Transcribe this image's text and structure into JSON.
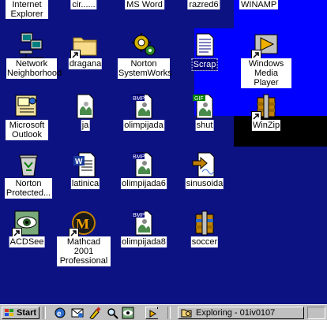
{
  "desktop": {
    "top_labels": [
      "Internet Explorer",
      "cir......",
      "MS Word",
      "razred6",
      "WINAMP"
    ],
    "icons": [
      {
        "label": "Network Neighborhood",
        "icon": "network-computers-icon"
      },
      {
        "label": "dragana",
        "icon": "folder-icon",
        "shortcut": true
      },
      {
        "label": "Norton SystemWorks",
        "icon": "gear-tools-icon"
      },
      {
        "label": "Scrap",
        "icon": "scrap-document-icon",
        "selected": true
      },
      {
        "label": "Windows Media Player",
        "icon": "media-player-icon",
        "shortcut": true
      },
      {
        "label": "Microsoft Outlook",
        "icon": "outlook-icon"
      },
      {
        "label": "ja",
        "icon": "image-file-icon"
      },
      {
        "label": "olimpijada",
        "icon": "bmp-file-icon",
        "badge": "BMP"
      },
      {
        "label": "shut",
        "icon": "gif-file-icon",
        "badge": "GIF"
      },
      {
        "label": "WinZip",
        "icon": "winzip-icon",
        "shortcut": true
      },
      {
        "label": "Norton Protected...",
        "icon": "recycle-bin-icon"
      },
      {
        "label": "latinica",
        "icon": "word-document-icon"
      },
      {
        "label": "olimpijada6",
        "icon": "bmp-file-icon",
        "badge": "BMP"
      },
      {
        "label": "sinusoida",
        "icon": "shortcut-image-icon"
      },
      {
        "label": "ACDSee",
        "icon": "acdsee-eye-icon",
        "shortcut": true
      },
      {
        "label": "Mathcad 2001 Professional",
        "icon": "mathcad-icon",
        "shortcut": true
      },
      {
        "label": "olimpijada8",
        "icon": "bmp-file-icon",
        "badge": "BMP"
      },
      {
        "label": "soccer",
        "icon": "winzip-archive-icon"
      }
    ]
  },
  "taskbar": {
    "start_label": "Start",
    "quick_launch": [
      "internet-explorer-icon",
      "outlook-express-icon",
      "paint-icon",
      "search-icon",
      "acdsee-icon",
      "media-player-icon"
    ],
    "task_label": "Exploring - 01iv0107"
  },
  "colors": {
    "desktop": "#0c1282",
    "highlight": "#0000fe",
    "taskbar": "#c0c0c0"
  }
}
